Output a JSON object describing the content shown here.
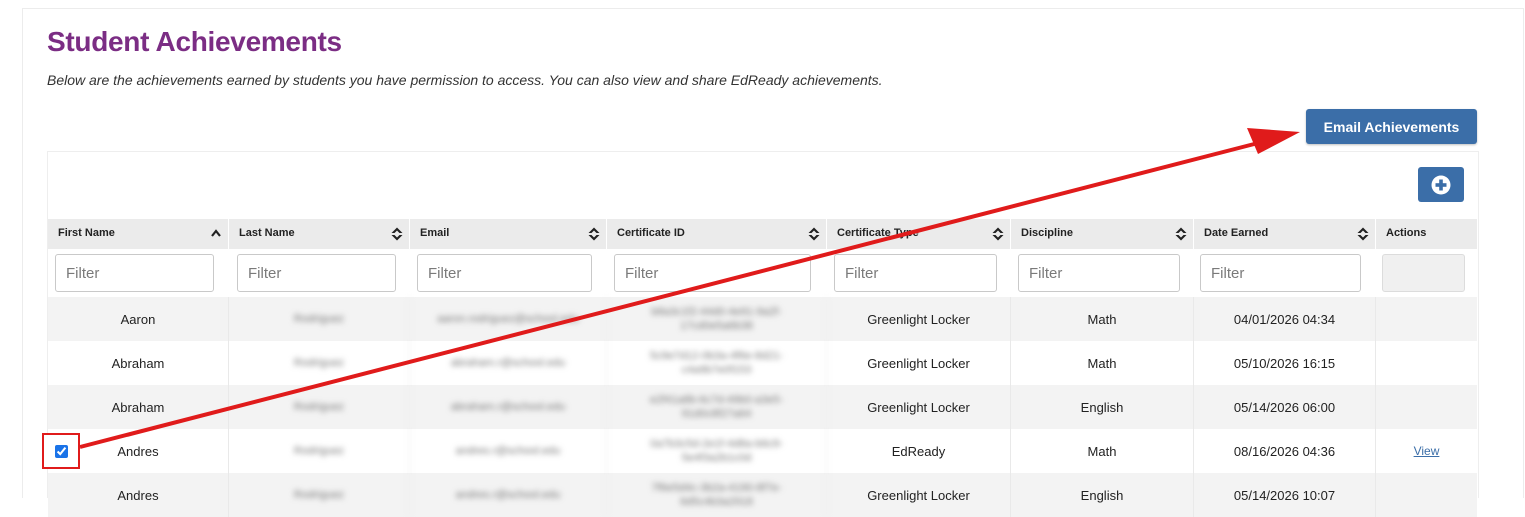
{
  "page": {
    "title": "Student Achievements",
    "subtitle": "Below are the achievements earned by students you have permission to access. You can also view and share EdReady achievements."
  },
  "toolbar": {
    "email_label": "Email Achievements",
    "add_icon": "plus-circle-icon"
  },
  "table": {
    "columns": [
      {
        "label": "First Name",
        "sort": "ascending"
      },
      {
        "label": "Last Name",
        "sort": "unsorted"
      },
      {
        "label": "Email",
        "sort": "unsorted"
      },
      {
        "label": "Certificate ID",
        "sort": "unsorted"
      },
      {
        "label": "Certificate Type",
        "sort": "unsorted"
      },
      {
        "label": "Discipline",
        "sort": "unsorted"
      },
      {
        "label": "Date Earned",
        "sort": "unsorted"
      },
      {
        "label": "Actions",
        "sort": "none"
      }
    ],
    "filter_placeholder": "Filter",
    "rows": [
      {
        "first": "Aaron",
        "last": "Rodriguez",
        "email": "aaron.rodriguez@school.edu",
        "cert_id": "b8a3c1f2-44d0-4e91-9a2f-17cd0e5a6b38",
        "type": "Greenlight Locker",
        "discipline": "Math",
        "date": "04/01/2026 04:34",
        "action": "",
        "checked": false
      },
      {
        "first": "Abraham",
        "last": "Rodriguez",
        "email": "abraham.r@school.edu",
        "cert_id": "5c9e7d12-0b3a-4f6e-8d21-c4a9b7e0f153",
        "type": "Greenlight Locker",
        "discipline": "Math",
        "date": "05/10/2026 16:15",
        "action": "",
        "checked": false
      },
      {
        "first": "Abraham",
        "last": "Rodriguez",
        "email": "abraham.r@school.edu",
        "cert_id": "e2f41a8b-6c7d-49b0-a3e5-91d0c8f27a64",
        "type": "Greenlight Locker",
        "discipline": "English",
        "date": "05/14/2026 06:00",
        "action": "",
        "checked": false
      },
      {
        "first": "Andres",
        "last": "Rodriguez",
        "email": "andres.r@school.edu",
        "cert_id": "0a7b3c5d-2e1f-4d8a-b6c9-5e4f3a2b1c0d",
        "type": "EdReady",
        "discipline": "Math",
        "date": "08/16/2026 04:36",
        "action": "View",
        "checked": true
      },
      {
        "first": "Andres",
        "last": "Rodriguez",
        "email": "andres.r@school.edu",
        "cert_id": "7f6e5d4c-3b2a-4190-8f7e-6d5c4b3a2918",
        "type": "Greenlight Locker",
        "discipline": "English",
        "date": "05/14/2026 10:07",
        "action": "",
        "checked": false
      }
    ]
  },
  "annotation": {
    "color": "#e01b1b"
  }
}
